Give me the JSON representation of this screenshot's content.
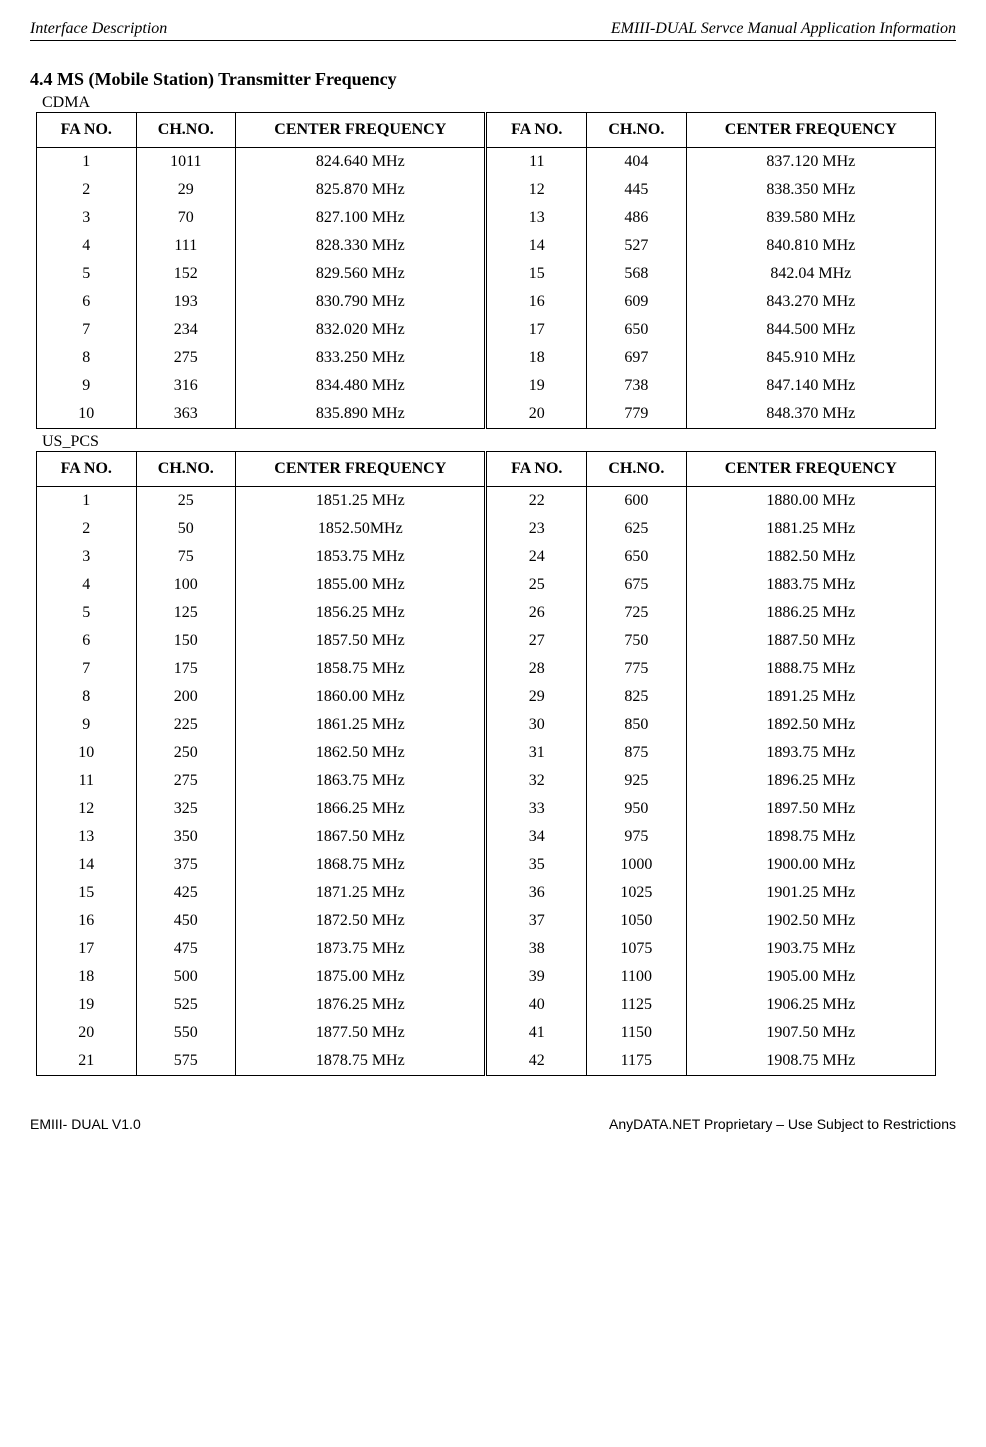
{
  "header": {
    "left": "Interface Description",
    "right": "EMIII-DUAL Servce Manual Application Information"
  },
  "section_title": "4.4 MS (Mobile Station) Transmitter Frequency",
  "tables": [
    {
      "label": "CDMA",
      "headers": [
        "FA NO.",
        "CH.NO.",
        "CENTER FREQUENCY",
        "FA NO.",
        "CH.NO.",
        "CENTER FREQUENCY"
      ],
      "rows": [
        [
          "1",
          "1011",
          "824.640 MHz",
          "11",
          "404",
          "837.120 MHz"
        ],
        [
          "2",
          "29",
          "825.870 MHz",
          "12",
          "445",
          "838.350 MHz"
        ],
        [
          "3",
          "70",
          "827.100 MHz",
          "13",
          "486",
          "839.580 MHz"
        ],
        [
          "4",
          "111",
          "828.330 MHz",
          "14",
          "527",
          "840.810 MHz"
        ],
        [
          "5",
          "152",
          "829.560 MHz",
          "15",
          "568",
          "842.04 MHz"
        ],
        [
          "6",
          "193",
          "830.790 MHz",
          "16",
          "609",
          "843.270 MHz"
        ],
        [
          "7",
          "234",
          "832.020 MHz",
          "17",
          "650",
          "844.500 MHz"
        ],
        [
          "8",
          "275",
          "833.250 MHz",
          "18",
          "697",
          "845.910 MHz"
        ],
        [
          "9",
          "316",
          "834.480 MHz",
          "19",
          "738",
          "847.140 MHz"
        ],
        [
          "10",
          "363",
          "835.890 MHz",
          "20",
          "779",
          "848.370 MHz"
        ]
      ]
    },
    {
      "label": "US_PCS",
      "headers": [
        "FA NO.",
        "CH.NO.",
        "CENTER FREQUENCY",
        "FA NO.",
        "CH.NO.",
        "CENTER FREQUENCY"
      ],
      "rows": [
        [
          "1",
          "25",
          "1851.25 MHz",
          "22",
          "600",
          "1880.00 MHz"
        ],
        [
          "2",
          "50",
          "1852.50MHz",
          "23",
          "625",
          "1881.25 MHz"
        ],
        [
          "3",
          "75",
          "1853.75 MHz",
          "24",
          "650",
          "1882.50 MHz"
        ],
        [
          "4",
          "100",
          "1855.00 MHz",
          "25",
          "675",
          "1883.75 MHz"
        ],
        [
          "5",
          "125",
          "1856.25 MHz",
          "26",
          "725",
          "1886.25 MHz"
        ],
        [
          "6",
          "150",
          "1857.50 MHz",
          "27",
          "750",
          "1887.50 MHz"
        ],
        [
          "7",
          "175",
          "1858.75 MHz",
          "28",
          "775",
          "1888.75 MHz"
        ],
        [
          "8",
          "200",
          "1860.00 MHz",
          "29",
          "825",
          "1891.25 MHz"
        ],
        [
          "9",
          "225",
          "1861.25 MHz",
          "30",
          "850",
          "1892.50 MHz"
        ],
        [
          "10",
          "250",
          "1862.50 MHz",
          "31",
          "875",
          "1893.75 MHz"
        ],
        [
          "11",
          "275",
          "1863.75 MHz",
          "32",
          "925",
          "1896.25 MHz"
        ],
        [
          "12",
          "325",
          "1866.25 MHz",
          "33",
          "950",
          "1897.50 MHz"
        ],
        [
          "13",
          "350",
          "1867.50 MHz",
          "34",
          "975",
          "1898.75 MHz"
        ],
        [
          "14",
          "375",
          "1868.75 MHz",
          "35",
          "1000",
          "1900.00 MHz"
        ],
        [
          "15",
          "425",
          "1871.25 MHz",
          "36",
          "1025",
          "1901.25 MHz"
        ],
        [
          "16",
          "450",
          "1872.50 MHz",
          "37",
          "1050",
          "1902.50 MHz"
        ],
        [
          "17",
          "475",
          "1873.75 MHz",
          "38",
          "1075",
          "1903.75 MHz"
        ],
        [
          "18",
          "500",
          "1875.00 MHz",
          "39",
          "1100",
          "1905.00 MHz"
        ],
        [
          "19",
          "525",
          "1876.25 MHz",
          "40",
          "1125",
          "1906.25 MHz"
        ],
        [
          "20",
          "550",
          "1877.50 MHz",
          "41",
          "1150",
          "1907.50 MHz"
        ],
        [
          "21",
          "575",
          "1878.75 MHz",
          "42",
          "1175",
          "1908.75 MHz"
        ]
      ]
    }
  ],
  "footer": {
    "left": "EMIII- DUAL V1.0",
    "right": "AnyDATA.NET Proprietary – Use Subject to Restrictions"
  }
}
